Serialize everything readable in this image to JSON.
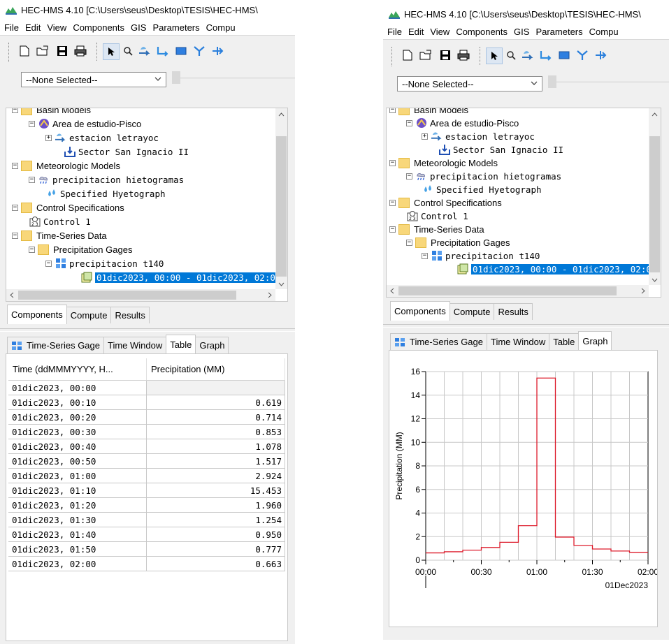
{
  "app": {
    "title": "HEC-HMS 4.10 [C:\\Users\\seus\\Desktop\\TESIS\\HEC-HMS\\",
    "menu": [
      "File",
      "Edit",
      "View",
      "Components",
      "GIS",
      "Parameters",
      "Compu"
    ]
  },
  "toolbar": {
    "icons": [
      "new-file-icon",
      "open-folder-icon",
      "save-icon",
      "print-icon",
      "arrow-select-icon",
      "zoom-icon",
      "subbasin-tool-icon",
      "reach-tool-icon",
      "reservoir-tool-icon",
      "junction-tool-icon",
      "diversion-tool-icon"
    ]
  },
  "selector": {
    "value": "--None Selected--"
  },
  "tree": {
    "basin_models": "Basin Models",
    "basin": "Area de estudio-Pisco",
    "subbasin": "estacion letrayoc",
    "sink": "Sector San Ignacio II",
    "met_models": "Meteorologic Models",
    "met_model": "precipitacion hietogramas",
    "hyetograph": "Specified Hyetograph",
    "control_specs": "Control Specifications",
    "control": "Control 1",
    "ts_data": "Time-Series Data",
    "precip_gages": "Precipitation Gages",
    "gage": "precipitacion t140",
    "window": "01dic2023, 00:00 - 01dic2023, 02:0"
  },
  "nav_tabs": {
    "components": "Components",
    "compute": "Compute",
    "results": "Results"
  },
  "editor_tabs": {
    "gage": "Time-Series Gage",
    "time_window": "Time Window",
    "table": "Table",
    "graph": "Graph"
  },
  "table": {
    "headers": [
      "Time (ddMMMYYYY, H...",
      "Precipitation (MM)"
    ],
    "rows": [
      [
        "01dic2023, 00:00",
        ""
      ],
      [
        "01dic2023, 00:10",
        "0.619"
      ],
      [
        "01dic2023, 00:20",
        "0.714"
      ],
      [
        "01dic2023, 00:30",
        "0.853"
      ],
      [
        "01dic2023, 00:40",
        "1.078"
      ],
      [
        "01dic2023, 00:50",
        "1.517"
      ],
      [
        "01dic2023, 01:00",
        "2.924"
      ],
      [
        "01dic2023, 01:10",
        "15.453"
      ],
      [
        "01dic2023, 01:20",
        "1.960"
      ],
      [
        "01dic2023, 01:30",
        "1.254"
      ],
      [
        "01dic2023, 01:40",
        "0.950"
      ],
      [
        "01dic2023, 01:50",
        "0.777"
      ],
      [
        "01dic2023, 02:00",
        "0.663"
      ]
    ]
  },
  "chart_data": {
    "type": "line",
    "step": true,
    "color": "#dd1c2c",
    "ylabel": "Precipitation (MM)",
    "xlabel": "01Dec2023",
    "ylim": [
      0,
      16
    ],
    "yticks": [
      0,
      2,
      4,
      6,
      8,
      10,
      12,
      14,
      16
    ],
    "xticks": [
      "00:00",
      "00:30",
      "01:00",
      "01:30",
      "02:00"
    ],
    "x_minutes": [
      0,
      10,
      20,
      30,
      40,
      50,
      60,
      70,
      80,
      90,
      100,
      110,
      120
    ],
    "values": [
      0.619,
      0.714,
      0.853,
      1.078,
      1.517,
      2.924,
      15.453,
      1.96,
      1.254,
      0.95,
      0.777,
      0.663
    ],
    "grid": true
  }
}
